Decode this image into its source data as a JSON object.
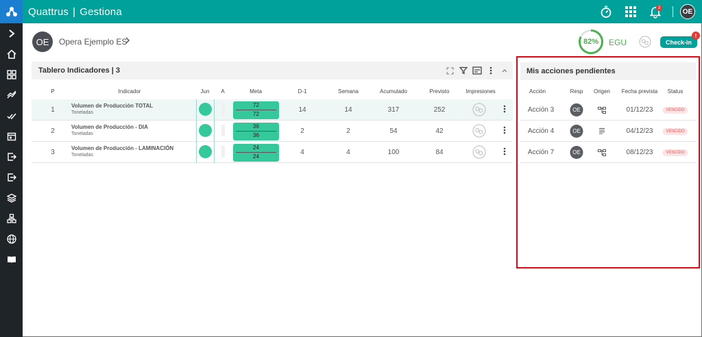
{
  "app": {
    "name": "Quattrus",
    "separator": "|",
    "module": "Gestiona"
  },
  "topbar": {
    "icons": [
      "stopwatch-icon",
      "apps-grid-icon",
      "bell-icon"
    ],
    "bell_count": "3",
    "user_initials": "OE"
  },
  "sidebar": {
    "icons": [
      "chevron-right-icon",
      "home-icon",
      "dashboard-icon",
      "chart-icon",
      "checklist-icon",
      "calendar-icon",
      "export-icon",
      "logout-icon",
      "layers-icon",
      "hierarchy-icon",
      "globe-icon",
      "book-icon"
    ]
  },
  "context": {
    "initials": "OE",
    "name": "Opera Ejemplo ES",
    "gauge_value": "82%",
    "gauge_fraction": 0.82,
    "unit_code": "EGU",
    "checkin_label": "Check-in",
    "checkin_badge": "!"
  },
  "dashboard": {
    "title": "Tablero Indicadores | 3",
    "columns": {
      "p": "P",
      "indicador": "Indicador",
      "jun": "Jun",
      "a": "A",
      "meta": "Meta",
      "d1": "D-1",
      "semana": "Semana",
      "acumulado": "Acumulado",
      "previsto": "Previsto",
      "impresiones": "Impresiones"
    },
    "rows": [
      {
        "p": "1",
        "name": "Volumen de Producción TOTAL",
        "unit": "Toneladas",
        "meta_top": "72",
        "meta_bottom": "72",
        "d1": "14",
        "semana": "14",
        "acumulado": "317",
        "previsto": "252"
      },
      {
        "p": "2",
        "name": "Volumen de Producción - DIA",
        "unit": "Toneladas",
        "meta_top": "36",
        "meta_bottom": "36",
        "d1": "2",
        "semana": "2",
        "acumulado": "54",
        "previsto": "42"
      },
      {
        "p": "3",
        "name": "Volumen de Producción - LAMINACIÓN",
        "unit": "Toneladas",
        "meta_top": "24",
        "meta_bottom": "24",
        "d1": "4",
        "semana": "4",
        "acumulado": "100",
        "previsto": "84"
      }
    ]
  },
  "pending": {
    "title": "Mis acciones pendientes",
    "columns": {
      "accion": "Acción",
      "resp": "Resp",
      "origen": "Origen",
      "fecha": "Fecha prevista",
      "status": "Status"
    },
    "rows": [
      {
        "accion": "Acción 3",
        "resp": "OE",
        "origen_icon": "hierarchy-icon",
        "fecha": "01/12/23",
        "status": "VENCIDO"
      },
      {
        "accion": "Acción 4",
        "resp": "OE",
        "origen_icon": "document-icon",
        "fecha": "04/12/23",
        "status": "VENCIDO"
      },
      {
        "accion": "Acción 7",
        "resp": "OE",
        "origen_icon": "hierarchy-icon",
        "fecha": "08/12/23",
        "status": "VENCIDO"
      }
    ]
  },
  "colors": {
    "primary": "#00a19a",
    "sidebar": "#1f2429",
    "success": "#35c89b",
    "alert": "#e30613"
  }
}
